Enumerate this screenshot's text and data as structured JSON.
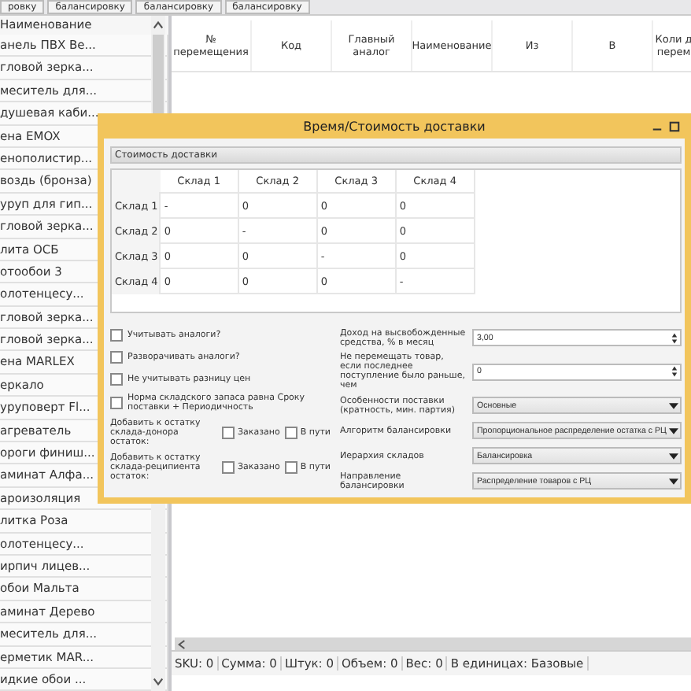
{
  "top_tabs": [
    "ровку",
    "балансировку",
    "балансировку",
    "балансировку"
  ],
  "product_list": {
    "header": "Наименование",
    "items": [
      "анель ПВХ Ве...",
      "гловой зерка...",
      "меситель для...",
      "душевая каби...",
      "ена EMOX",
      "енополистир...",
      "воздь (бронза)",
      "уруп для гип...",
      "гловой зерка...",
      "лита ОСБ",
      "отообои 3",
      "олотенцесу...",
      "гловой зерка...",
      "гловой зерка...",
      "ена MARLEX",
      "еркало",
      "уруповерт Fl...",
      "агреватель",
      "ороги финиш...",
      "аминат Алфа...",
      "ароизоляция",
      "литка Роза",
      "олотенцесу...",
      "ирпич лицев...",
      "обои Мальта",
      "аминат Дерево",
      "меситель для...",
      "ерметик MAR...",
      "идкие обои ..."
    ]
  },
  "transfer_table": {
    "columns": [
      "№ перемещения",
      "Код",
      "Главный аналог",
      "Наименование",
      "Из",
      "В",
      "Коли д перем"
    ]
  },
  "status_bar": [
    "SKU: 0",
    "Сумма: 0",
    "Штук: 0",
    "Объем: 0",
    "Вес: 0",
    "В единицах: Базовые"
  ],
  "dialog": {
    "title": "Время/Стоимость доставки",
    "section": "Стоимость доставки",
    "cost_grid": {
      "columns": [
        "Склад 1",
        "Склад 2",
        "Склад 3",
        "Склад 4"
      ],
      "rows": [
        {
          "label": "Склад 1",
          "cells": [
            "-",
            "0",
            "0",
            "0"
          ]
        },
        {
          "label": "Склад 2",
          "cells": [
            "0",
            "-",
            "0",
            "0"
          ]
        },
        {
          "label": "Склад 3",
          "cells": [
            "0",
            "0",
            "-",
            "0"
          ]
        },
        {
          "label": "Склад 4",
          "cells": [
            "0",
            "0",
            "0",
            "-"
          ]
        }
      ]
    },
    "options": [
      {
        "label": "Учитывать аналоги?",
        "checked": false
      },
      {
        "label": "Разворачивать аналоги?",
        "checked": false
      },
      {
        "label": "Не учитывать разницу цен",
        "checked": false
      },
      {
        "label": "Норма складского запаса равна Сроку поставки + Периодичность",
        "checked": false
      }
    ],
    "stock_additions": [
      {
        "label": "Добавить к остатку склада-донора остаток:",
        "flags": [
          {
            "label": "Заказано",
            "checked": false
          },
          {
            "label": "В пути",
            "checked": false
          }
        ]
      },
      {
        "label": "Добавить к остатку склада-реципиента остаток:",
        "flags": [
          {
            "label": "Заказано",
            "checked": false
          },
          {
            "label": "В пути",
            "checked": false
          }
        ]
      }
    ],
    "settings": [
      {
        "kind": "spinner",
        "label": "Доход на высвобожденные средства, % в месяц",
        "value": "3,00"
      },
      {
        "kind": "spinner",
        "label": "Не перемещать товар, если последнее поступление было раньше, чем",
        "value": "0"
      },
      {
        "kind": "dropdown",
        "label": "Особенности поставки (кратность, мин. партия)",
        "value": "Основные"
      },
      {
        "kind": "dropdown",
        "label": "Алгоритм балансировки",
        "value": "Пропорциональное распределение остатка с РЦ"
      },
      {
        "kind": "dropdown",
        "label": "Иерархия складов",
        "value": "Балансировка"
      },
      {
        "kind": "dropdown",
        "label": "Направление балансировки",
        "value": "Распределение товаров с РЦ"
      }
    ]
  }
}
